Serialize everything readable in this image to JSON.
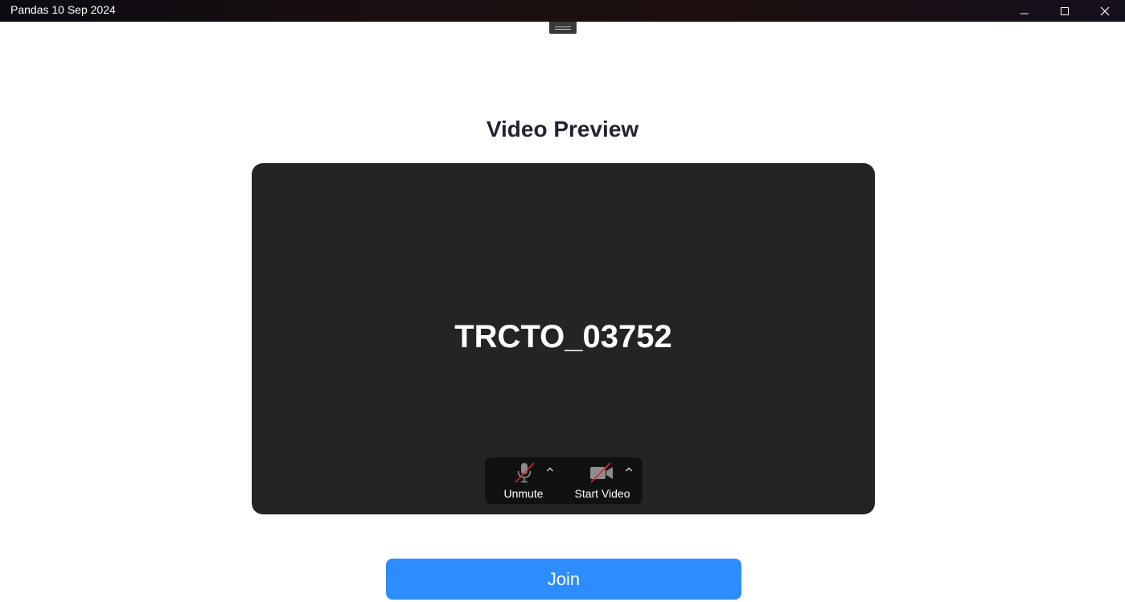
{
  "window": {
    "title": "Pandas 10 Sep 2024",
    "controls": [
      "minimize-icon",
      "maximize-icon",
      "close-icon"
    ]
  },
  "page": {
    "heading": "Video Preview"
  },
  "preview": {
    "participant_name": "TRCTO_03752",
    "background_color": "#242424"
  },
  "controls": {
    "audio": {
      "label": "Unmute",
      "icon": "microphone-muted-icon",
      "menu_icon": "chevron-up-icon"
    },
    "video": {
      "label": "Start Video",
      "icon": "video-camera-off-icon",
      "menu_icon": "chevron-up-icon"
    }
  },
  "join": {
    "label": "Join",
    "color": "#2d8cff"
  }
}
